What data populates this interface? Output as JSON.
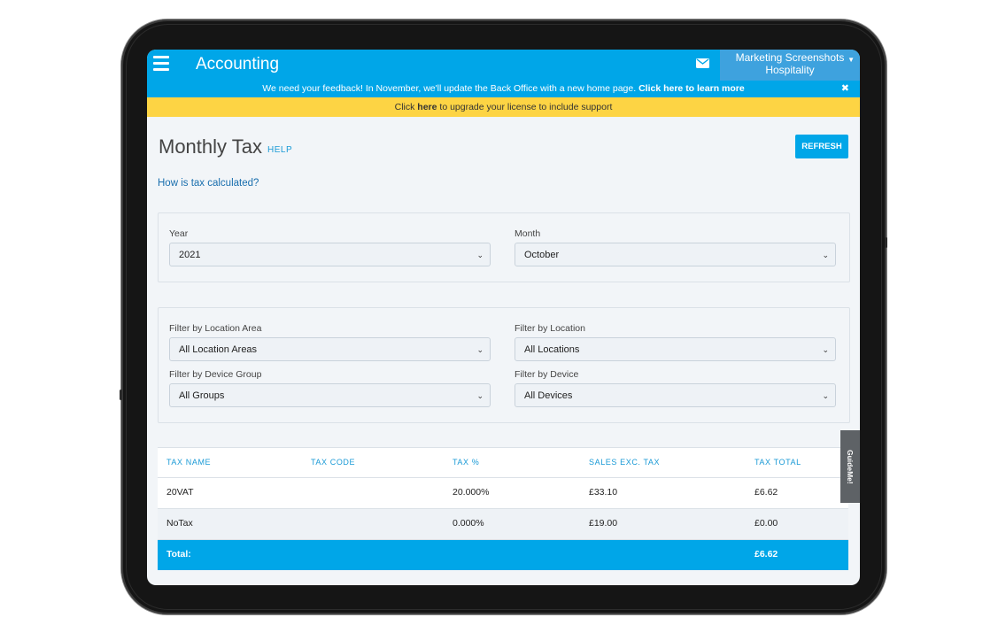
{
  "header": {
    "app_title": "Accounting",
    "account_line1": "Marketing Screenshots",
    "account_line2": "Hospitality",
    "menu_icon": "hamburger-icon",
    "mail_icon": "mail-icon"
  },
  "feedback_banner": {
    "text": "We need your feedback! In November, we'll update the Back Office with a new home page.",
    "link": "Click here to learn more",
    "close": "✖"
  },
  "upgrade_banner": {
    "prefix": "Click",
    "link": "here",
    "suffix": "to upgrade your license to include support"
  },
  "page": {
    "title": "Monthly Tax",
    "help_label": "HELP",
    "refresh_label": "REFRESH",
    "how_link": "How is tax calculated?"
  },
  "period": {
    "year_label": "Year",
    "year_value": "2021",
    "month_label": "Month",
    "month_value": "October"
  },
  "filters": {
    "location_area_label": "Filter by Location Area",
    "location_area_value": "All Location Areas",
    "location_label": "Filter by Location",
    "location_value": "All Locations",
    "device_group_label": "Filter by Device Group",
    "device_group_value": "All Groups",
    "device_label": "Filter by Device",
    "device_value": "All Devices"
  },
  "table": {
    "headers": [
      "TAX NAME",
      "TAX CODE",
      "TAX %",
      "SALES EXC. TAX",
      "TAX TOTAL"
    ],
    "rows": [
      {
        "name": "20VAT",
        "code": "",
        "pct": "20.000%",
        "sales": "£33.10",
        "total": "£6.62"
      },
      {
        "name": "NoTax",
        "code": "",
        "pct": "0.000%",
        "sales": "£19.00",
        "total": "£0.00"
      }
    ],
    "total_label": "Total:",
    "total_value": "£6.62"
  },
  "guideme_label": "GuideMe!",
  "colors": {
    "primary": "#00a6e8",
    "banner_yellow": "#fdd444",
    "background": "#f2f5f8"
  }
}
